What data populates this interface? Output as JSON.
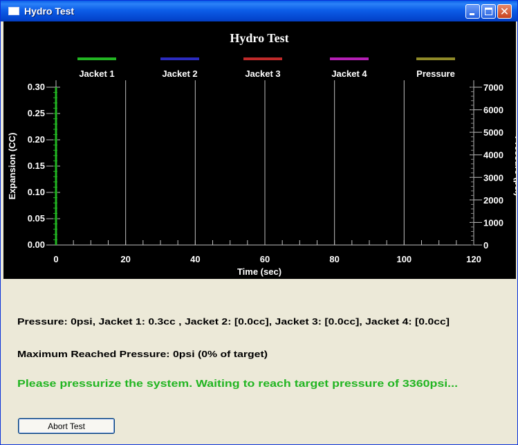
{
  "window": {
    "title": "Hydro Test",
    "close_glyph": "✕"
  },
  "chart_data": {
    "type": "line",
    "title": "Hydro Test",
    "xlabel": "Time (sec)",
    "ylabel": "Expansion (CC)",
    "y2label": "Pressure (psi)",
    "xlim": [
      0,
      120
    ],
    "ylim": [
      0,
      0.3
    ],
    "y2lim": [
      0,
      7000
    ],
    "x_ticks": [
      "0",
      "20",
      "40",
      "60",
      "80",
      "100",
      "120"
    ],
    "y_ticks": [
      "0.00",
      "0.05",
      "0.10",
      "0.15",
      "0.20",
      "0.25",
      "0.30"
    ],
    "y2_ticks": [
      "0",
      "1000",
      "2000",
      "3000",
      "4000",
      "5000",
      "6000",
      "7000"
    ],
    "grid": true,
    "legend_placement": "top",
    "series": [
      {
        "name": "Jacket 1",
        "color": "#22b522",
        "axis": "left",
        "x": [
          0,
          0
        ],
        "y": [
          0.0,
          0.3
        ]
      },
      {
        "name": "Jacket 2",
        "color": "#2b2bbf",
        "axis": "left",
        "x": [],
        "y": []
      },
      {
        "name": "Jacket 3",
        "color": "#c02a2a",
        "axis": "left",
        "x": [],
        "y": []
      },
      {
        "name": "Jacket 4",
        "color": "#b51fb5",
        "axis": "left",
        "x": [],
        "y": []
      },
      {
        "name": "Pressure",
        "color": "#8f8a28",
        "axis": "right",
        "x": [],
        "y": []
      }
    ]
  },
  "status": {
    "readings": "Pressure: 0psi, Jacket 1:  0.3cc , Jacket 2: [0.0cc], Jacket 3: [0.0cc], Jacket 4: [0.0cc]",
    "max_pressure": "Maximum Reached Pressure: 0psi (0% of target)",
    "instruction": "Please pressurize the system. Waiting to reach target pressure of 3360psi..."
  },
  "buttons": {
    "abort_label": "Abort Test"
  }
}
